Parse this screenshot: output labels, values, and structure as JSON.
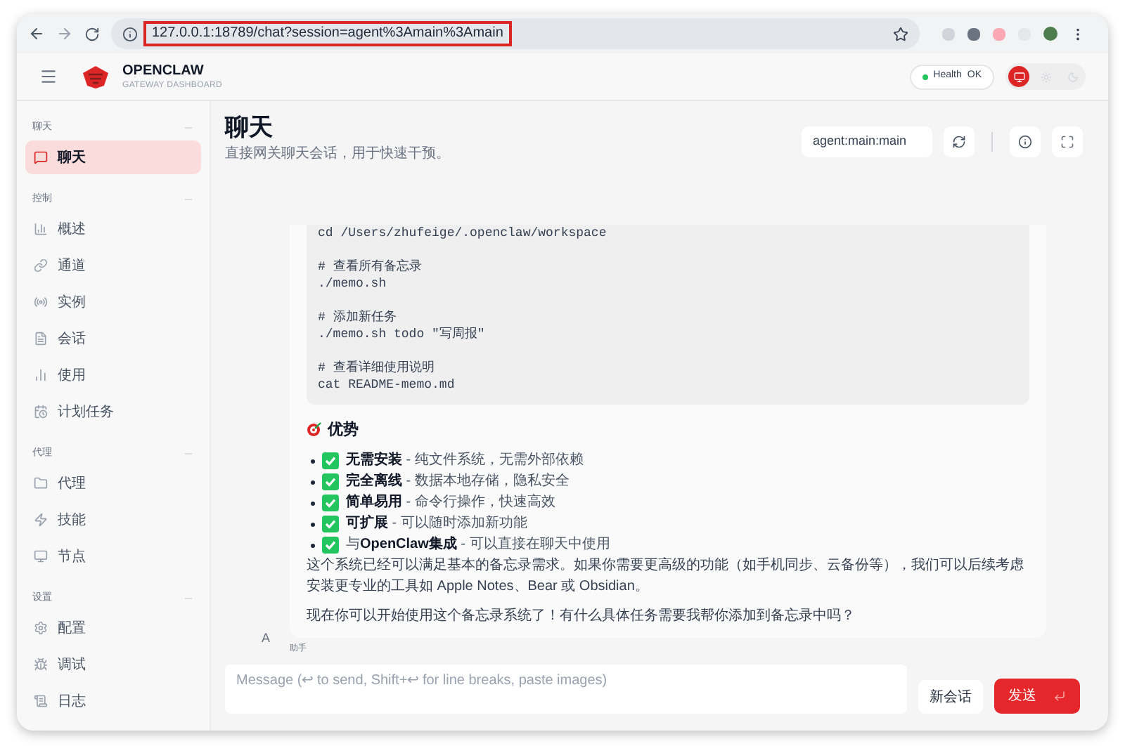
{
  "browser": {
    "url": "127.0.0.1:18789/chat?session=agent%3Amain%3Amain"
  },
  "app": {
    "brand": "OPENCLAW",
    "subtitle": "GATEWAY DASHBOARD",
    "health": {
      "label": "Health",
      "value": "OK",
      "ok": true
    },
    "theme_modes": [
      {
        "selected": true
      },
      {
        "selected": false
      },
      {
        "selected": false
      }
    ]
  },
  "sidebar": {
    "groups": [
      {
        "label": "聊天",
        "items": [
          {
            "label": "聊天",
            "selected": true
          }
        ]
      },
      {
        "label": "控制",
        "items": [
          {
            "label": "概述",
            "selected": false
          },
          {
            "label": "通道",
            "selected": false
          },
          {
            "label": "实例",
            "selected": false
          },
          {
            "label": "会话",
            "selected": false
          },
          {
            "label": "使用",
            "selected": false
          },
          {
            "label": "计划任务",
            "selected": false
          }
        ]
      },
      {
        "label": "代理",
        "items": [
          {
            "label": "代理",
            "selected": false
          },
          {
            "label": "技能",
            "selected": false
          },
          {
            "label": "节点",
            "selected": false
          }
        ]
      },
      {
        "label": "设置",
        "items": [
          {
            "label": "配置",
            "selected": false
          },
          {
            "label": "调试",
            "selected": false
          },
          {
            "label": "日志",
            "selected": false
          }
        ]
      }
    ]
  },
  "page": {
    "title": "聊天",
    "subtitle": "直接网关聊天会话，用于快速干预。",
    "session": "agent:main:main"
  },
  "message": {
    "code_groups": [
      [
        "cd /Users/zhufeige/.openclaw/workspace"
      ],
      [
        "# 查看所有备忘录",
        "./memo.sh"
      ],
      [
        "# 添加新任务",
        "./memo.sh todo \"写周报\""
      ],
      [
        "# 查看详细使用说明",
        "cat README-memo.md"
      ]
    ],
    "heading": "优势",
    "bullets": [
      "**无需安装** - 纯文件系统，无需外部依赖",
      "**完全离线** - 数据本地存储，隐私安全",
      "**简单易用** - 命令行操作，快速高效",
      "**可扩展** - 可以随时添加新功能",
      "与**OpenClaw集成** - 可以直接在聊天中使用"
    ],
    "paragraphs": [
      "这个系统已经可以满足基本的备忘录需求。如果你需要更高级的功能（如手机同步、云备份等），我们可以后续考虑安装更专业的工具如 Apple Notes、Bear 或 Obsidian。",
      "现在你可以开始使用这个备忘录系统了！有什么具体任务需要我帮你添加到备忘录中吗？"
    ],
    "avatar": "A",
    "sender": "助手"
  },
  "composer": {
    "placeholder": "Message (↩ to send, Shift+↩ for line breaks, paste images)",
    "new_session": "新会话",
    "send": "发送"
  }
}
